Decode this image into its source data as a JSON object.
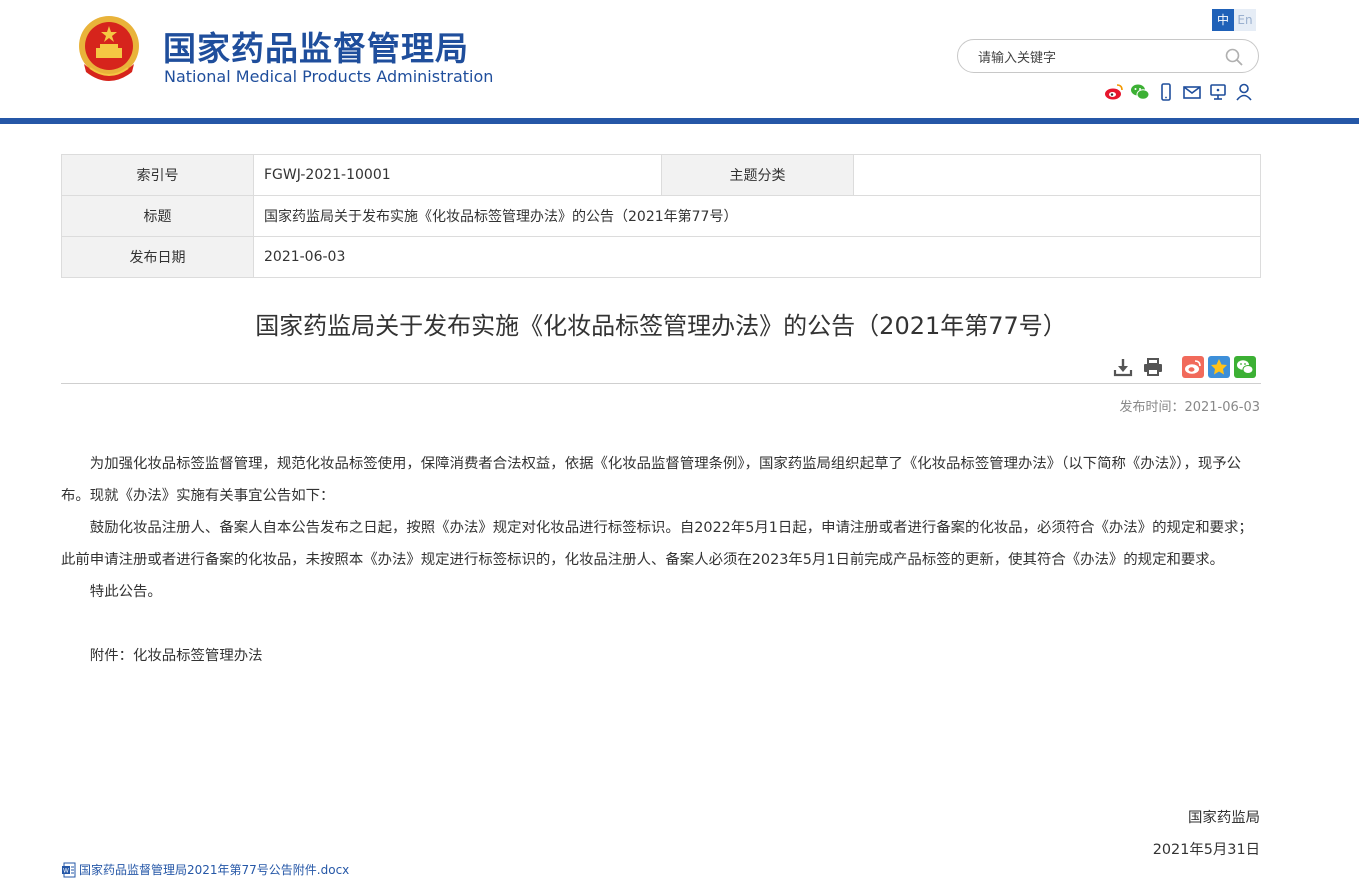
{
  "header": {
    "title_cn": "国家药品监督管理局",
    "title_en": "National Medical Products Administration",
    "lang_zh": "中",
    "lang_en": "En",
    "search_placeholder": "请输入关键字"
  },
  "meta": {
    "index_label": "索引号",
    "index_value": "FGWJ-2021-10001",
    "category_label": "主题分类",
    "category_value": "",
    "title_label": "标题",
    "title_value": "国家药监局关于发布实施《化妆品标签管理办法》的公告（2021年第77号）",
    "date_label": "发布日期",
    "date_value": "2021-06-03"
  },
  "article": {
    "title": "国家药监局关于发布实施《化妆品标签管理办法》的公告（2021年第77号）",
    "publish_time": "发布时间：2021-06-03",
    "paragraphs": [
      "为加强化妆品标签监督管理，规范化妆品标签使用，保障消费者合法权益，依据《化妆品监督管理条例》，国家药监局组织起草了《化妆品标签管理办法》（以下简称《办法》），现予公布。现就《办法》实施有关事宜公告如下：",
      "鼓励化妆品注册人、备案人自本公告发布之日起，按照《办法》规定对化妆品进行标签标识。自2022年5月1日起，申请注册或者进行备案的化妆品，必须符合《办法》的规定和要求；此前申请注册或者进行备案的化妆品，未按照本《办法》规定进行标签标识的，化妆品注册人、备案人必须在2023年5月1日前完成产品标签的更新，使其符合《办法》的规定和要求。",
      "特此公告。"
    ],
    "attachment_line": "附件：化妆品标签管理办法",
    "signer": "国家药监局",
    "sign_date": "2021年5月31日",
    "attachment_file": "国家药品监督管理局2021年第77号公告附件.docx"
  },
  "colors": {
    "brand_blue": "#1f4e9c",
    "link_blue": "#2557a7"
  }
}
